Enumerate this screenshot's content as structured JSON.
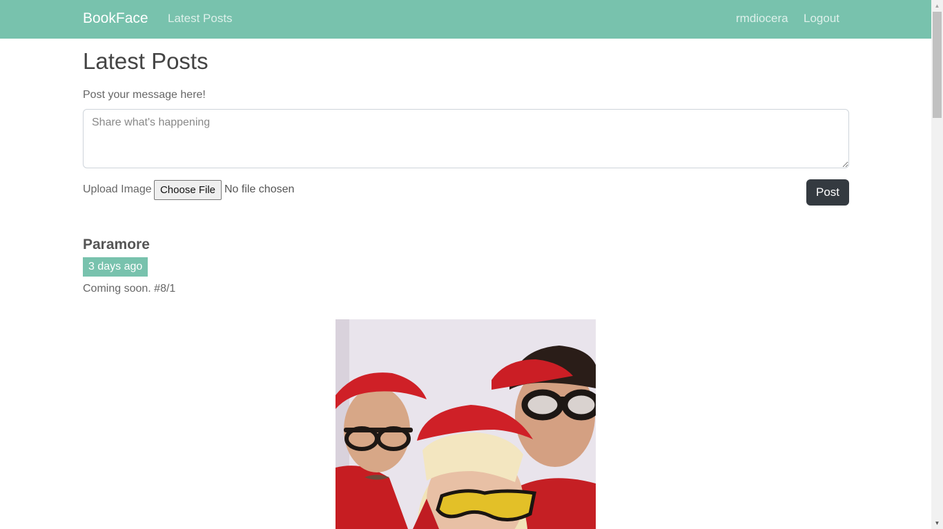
{
  "navbar": {
    "brand": "BookFace",
    "latest_posts": "Latest Posts",
    "username": "rmdiocera",
    "logout": "Logout"
  },
  "page": {
    "title": "Latest Posts"
  },
  "composer": {
    "label": "Post your message here!",
    "placeholder": "Share what's happening",
    "upload_label": "Upload Image",
    "choose_file": "Choose File",
    "file_status": "No file chosen",
    "post_button": "Post"
  },
  "posts": [
    {
      "author": "Paramore",
      "time": "3 days ago",
      "text": "Coming soon. #8/1"
    }
  ],
  "colors": {
    "primary": "#78c2ad",
    "dark": "#343a40"
  }
}
